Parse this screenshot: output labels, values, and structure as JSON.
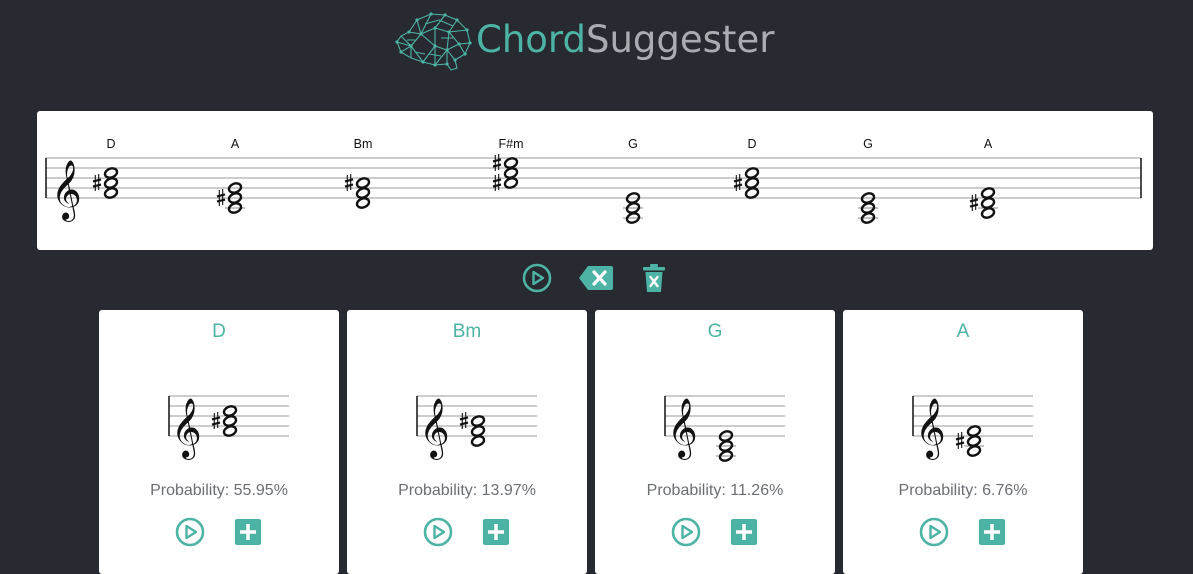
{
  "app": {
    "name_part1": "Chord",
    "name_part2": "Suggester",
    "accent_color": "#4db3a4",
    "background_color": "#272a31"
  },
  "progression": {
    "chords": [
      "D",
      "A",
      "Bm",
      "F#m",
      "G",
      "D",
      "G",
      "A"
    ]
  },
  "controls": {
    "play_icon": "play-circle-icon",
    "backspace_icon": "backspace-icon",
    "delete_icon": "trash-icon"
  },
  "suggestions": [
    {
      "chord": "D",
      "probability_label": "Probability: 55.95%"
    },
    {
      "chord": "Bm",
      "probability_label": "Probability: 13.97%"
    },
    {
      "chord": "G",
      "probability_label": "Probability: 11.26%"
    },
    {
      "chord": "A",
      "probability_label": "Probability: 6.76%"
    }
  ]
}
